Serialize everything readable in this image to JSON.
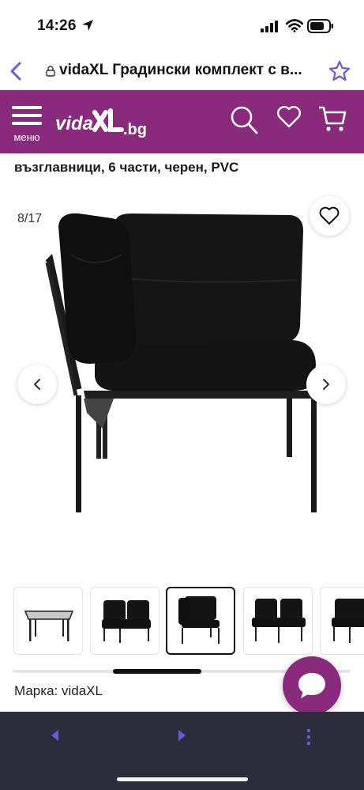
{
  "status_bar": {
    "time": "14:26",
    "icons": [
      "location-arrow-icon",
      "cellular-signal-icon",
      "wifi-icon",
      "battery-icon"
    ]
  },
  "browser": {
    "url_text": "vidaXL Градински комплект с в...",
    "icons": [
      "back-chevron-icon",
      "lock-icon",
      "bookmark-star-icon"
    ]
  },
  "site_header": {
    "menu_label": "меню",
    "logo_text": "vidaXL",
    "logo_suffix": ".bg",
    "icons": [
      "search-icon",
      "heart-icon",
      "cart-icon"
    ],
    "background_color": "#8a2a7c"
  },
  "product": {
    "title_visible": "възглавници, 6 части, черен, PVC",
    "brand_label": "Марка: vidaXL"
  },
  "gallery": {
    "counter": "8/17",
    "current_image": 8,
    "total_images": 17,
    "thumbnails": [
      {
        "name": "glass-table",
        "active": false
      },
      {
        "name": "corner-chair-front",
        "active": false
      },
      {
        "name": "corner-chair-side",
        "active": true
      },
      {
        "name": "corner-chairs-pair",
        "active": false
      },
      {
        "name": "chair-partial",
        "active": false
      }
    ]
  },
  "colors": {
    "brand_purple": "#8a2a7c",
    "toolbar_dark": "#2b2e3a",
    "accent_violet": "#6b5bd6"
  }
}
